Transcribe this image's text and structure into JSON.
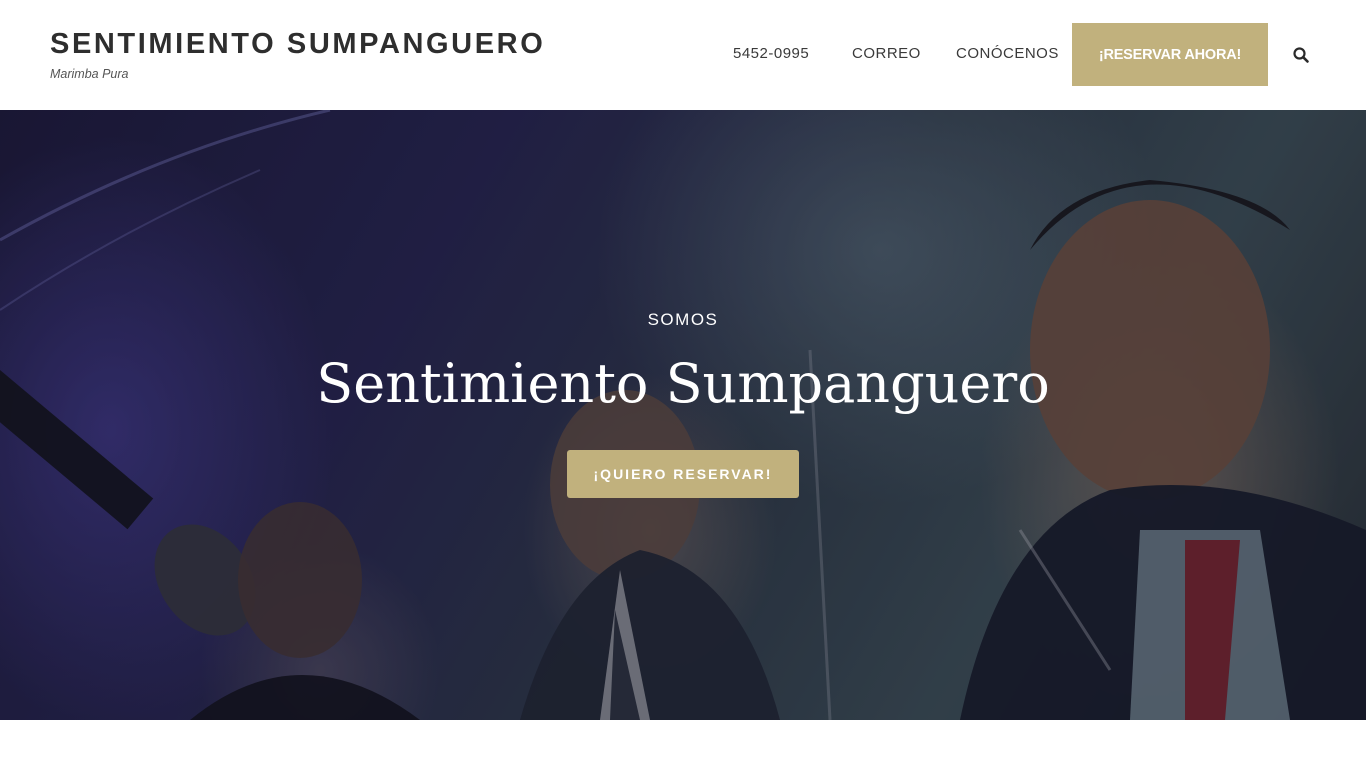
{
  "brand": {
    "title": "SENTIMIENTO SUMPANGUERO",
    "tagline": "Marimba Pura"
  },
  "nav": {
    "items": [
      {
        "label": "5452-0995"
      },
      {
        "label": "CORREO"
      },
      {
        "label": "CONÓCENOS"
      }
    ],
    "cta_label": "¡RESERVAR AHORA!",
    "search_icon": "search-icon"
  },
  "hero": {
    "kicker": "SOMOS",
    "title": "Sentimiento Sumpanguero",
    "button_label": "¡QUIERO RESERVAR!",
    "background": "photo of marimba players performing on stage"
  },
  "colors": {
    "accent": "#c1b17d",
    "header_bg": "#ffffff",
    "text_dark": "#2e2e2e"
  }
}
